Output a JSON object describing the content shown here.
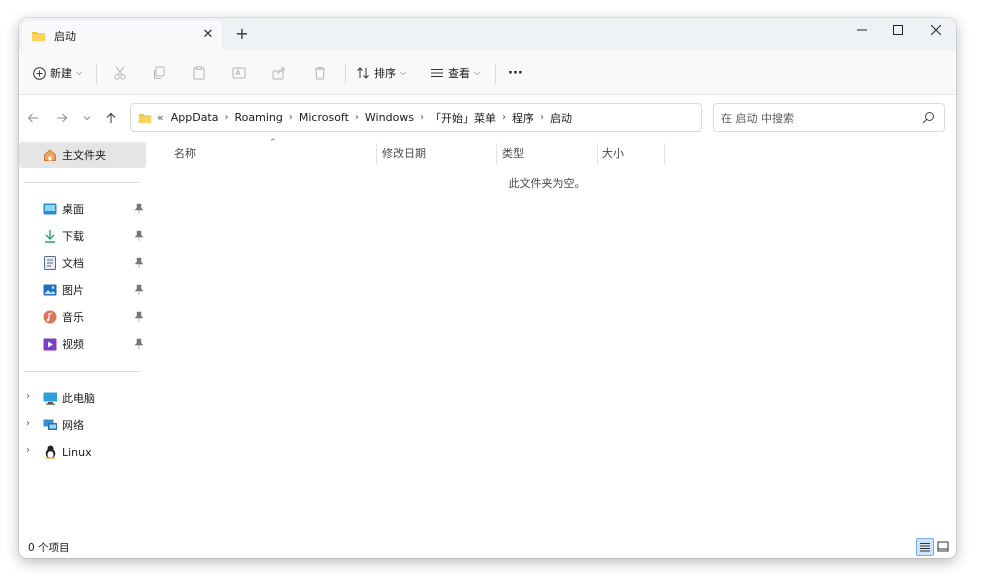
{
  "titlebar": {
    "tab_label": "启动",
    "tab_close": "✕",
    "new_tab": "+"
  },
  "toolbar": {
    "new_label": "新建",
    "sort_label": "排序",
    "view_label": "查看",
    "more_label": "···"
  },
  "addressbar": {
    "crumbs": [
      "AppData",
      "Roaming",
      "Microsoft",
      "Windows",
      "「开始」菜单",
      "程序",
      "启动"
    ],
    "overflow": "«"
  },
  "search": {
    "placeholder": "在 启动 中搜索"
  },
  "sidebar": {
    "home_label": "主文件夹",
    "pinned": [
      {
        "label": "桌面",
        "icon": "desktop-icon"
      },
      {
        "label": "下载",
        "icon": "download-icon"
      },
      {
        "label": "文档",
        "icon": "document-icon"
      },
      {
        "label": "图片",
        "icon": "picture-icon"
      },
      {
        "label": "音乐",
        "icon": "music-icon"
      },
      {
        "label": "视频",
        "icon": "video-icon"
      }
    ],
    "tree": [
      {
        "label": "此电脑",
        "icon": "computer-icon"
      },
      {
        "label": "网络",
        "icon": "network-icon"
      },
      {
        "label": "Linux",
        "icon": "linux-icon"
      }
    ]
  },
  "columns": {
    "name": "名称",
    "modified": "修改日期",
    "type": "类型",
    "size": "大小"
  },
  "content": {
    "empty_message": "此文件夹为空。"
  },
  "statusbar": {
    "item_count": "0 个项目"
  },
  "colors": {
    "accent": "#0067c0",
    "folder": "#f3c043",
    "selected_bg": "#e5e5e5"
  }
}
